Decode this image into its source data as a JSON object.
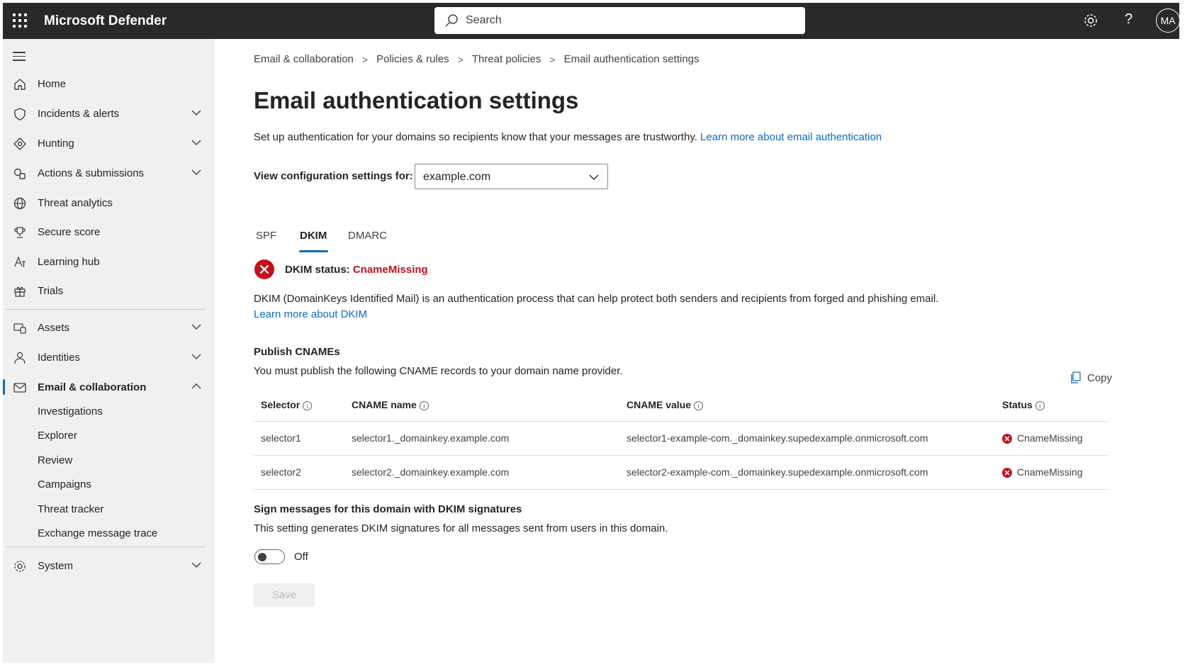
{
  "app": {
    "title": "Microsoft Defender"
  },
  "search": {
    "placeholder": "Search"
  },
  "topbar": {
    "avatar_initials": "MA"
  },
  "sidebar": {
    "items": [
      {
        "label": "Home",
        "icon": "home-icon"
      },
      {
        "label": "Incidents & alerts",
        "icon": "shield-icon"
      },
      {
        "label": "Hunting",
        "icon": "hunting-icon"
      },
      {
        "label": "Actions & submissions",
        "icon": "actions-icon"
      },
      {
        "label": "Threat analytics",
        "icon": "globe-icon"
      },
      {
        "label": "Secure score",
        "icon": "trophy-icon"
      },
      {
        "label": "Learning hub",
        "icon": "learning-icon"
      },
      {
        "label": "Trials",
        "icon": "gift-icon"
      },
      {
        "label": "Assets",
        "icon": "assets-icon"
      },
      {
        "label": "Identities",
        "icon": "person-icon"
      },
      {
        "label": "Email & collaboration",
        "icon": "mail-icon"
      },
      {
        "label": "System",
        "icon": "gear-icon"
      }
    ],
    "email_subitems": [
      "Investigations",
      "Explorer",
      "Review",
      "Campaigns",
      "Threat tracker",
      "Exchange message trace"
    ]
  },
  "breadcrumb": [
    "Email & collaboration",
    "Policies & rules",
    "Threat policies",
    "Email authentication settings"
  ],
  "page": {
    "title": "Email authentication settings",
    "intro": "Set up authentication for your domains so recipients know that your messages are trustworthy.",
    "intro_link": "Learn more about email authentication",
    "config_label": "View configuration settings for:",
    "domain": "example.com"
  },
  "tabs": [
    "SPF",
    "DKIM",
    "DMARC"
  ],
  "dkim": {
    "status_label": "DKIM status:",
    "status_value": "CnameMissing",
    "description": "DKIM (DomainKeys Identified Mail) is an authentication process that can help protect both senders and recipients from forged and phishing email.",
    "learn_link": "Learn more about DKIM",
    "publish_title": "Publish CNAMEs",
    "publish_text": "You must publish the following CNAME records to your domain name provider.",
    "copy_label": "Copy",
    "columns": [
      "Selector",
      "CNAME name",
      "CNAME value",
      "Status"
    ],
    "rows": [
      {
        "selector": "selector1",
        "name": "selector1._domainkey.example.com",
        "value": "selector1-example-com._domainkey.supedexample.onmicrosoft.com",
        "status": "CnameMissing"
      },
      {
        "selector": "selector2",
        "name": "selector2._domainkey.example.com",
        "value": "selector2-example-com._domainkey.supedexample.onmicrosoft.com",
        "status": "CnameMissing"
      }
    ],
    "sign_title": "Sign messages for this domain with DKIM signatures",
    "sign_text": "This setting generates DKIM signatures for all messages sent from users in this domain.",
    "toggle_label": "Off",
    "save_label": "Save"
  },
  "colors": {
    "accent": "#0f6cbd",
    "error": "#c50f1f",
    "topbar": "#292929"
  }
}
